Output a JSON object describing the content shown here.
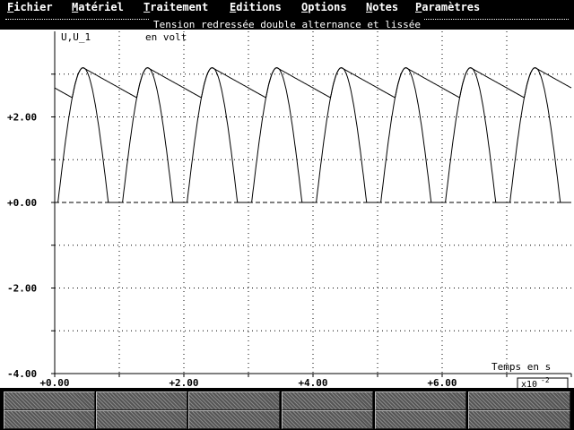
{
  "menu": {
    "items": [
      {
        "label": "Fichier",
        "accel": "F"
      },
      {
        "label": "Matériel",
        "accel": "M"
      },
      {
        "label": "Traitement",
        "accel": "T"
      },
      {
        "label": "Editions",
        "accel": "E"
      },
      {
        "label": "Options",
        "accel": "O"
      },
      {
        "label": "Notes",
        "accel": "N"
      },
      {
        "label": "Paramètres",
        "accel": "P"
      }
    ]
  },
  "window": {
    "title": "Tension redressée double alternance et lissée"
  },
  "chart_data": {
    "type": "line",
    "ylabel": "U,U_1",
    "yunit": "en volt",
    "xlabel": "Temps en s",
    "xscale_label": "x10^-2",
    "x_ticks": [
      "+0.00",
      "+2.00",
      "+4.00",
      "+6.00"
    ],
    "y_ticks": [
      "+2.00",
      "+0.00",
      "-2.00",
      "-4.00"
    ],
    "xlim": [
      0,
      8
    ],
    "ylim": [
      -4,
      4
    ],
    "grid": true,
    "zero_line": "dashed",
    "series": [
      {
        "name": "U",
        "kind": "full-wave rectified sine",
        "amplitude": 3.15,
        "half_period": 1,
        "start_phase": 0.5
      },
      {
        "name": "U_1",
        "kind": "smoothed (ripple)",
        "peak": 3.15,
        "min_before_recharge": 2.45
      }
    ]
  },
  "toolbar": {
    "row1": [
      "",
      "",
      "",
      "",
      "",
      ""
    ],
    "row2": [
      "",
      "",
      "",
      "",
      "",
      ""
    ]
  }
}
